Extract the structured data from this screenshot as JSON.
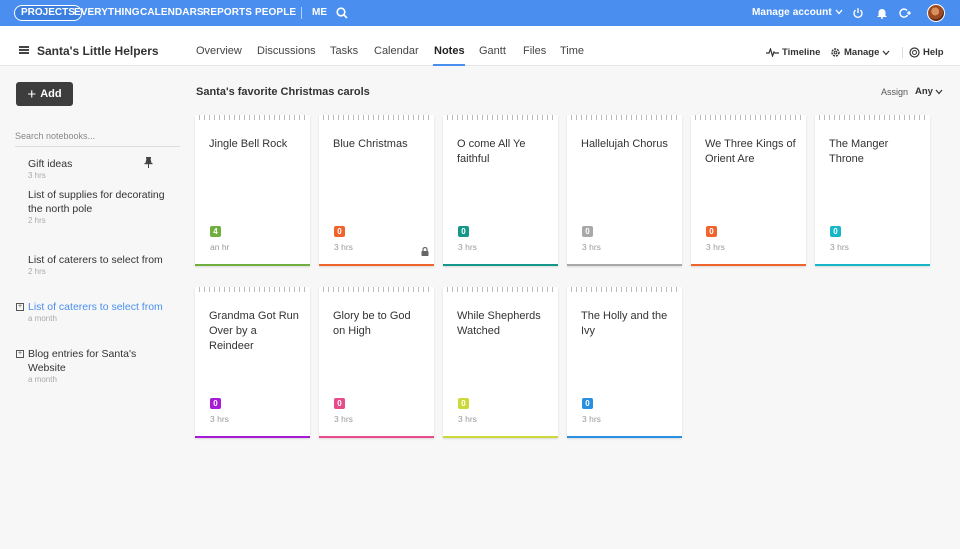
{
  "topnav": {
    "projects": "PROJECTS",
    "everything": "EVERYTHING",
    "calendars": "CALENDARS",
    "reports": "REPORTS",
    "people": "PEOPLE",
    "me": "ME",
    "manage_account": "Manage account",
    "icons": [
      "search-icon",
      "power-icon",
      "bell-icon",
      "add-user-icon",
      "avatar"
    ]
  },
  "header": {
    "project_title": "Santa's Little Helpers",
    "tabs": [
      "Overview",
      "Discussions",
      "Tasks",
      "Calendar",
      "Notes",
      "Gantt",
      "Files",
      "Time"
    ],
    "active_tab": "Notes",
    "timeline": "Timeline",
    "manage": "Manage",
    "help": "Help"
  },
  "sidebar": {
    "add_label": "Add",
    "search_placeholder": "Search notebooks...",
    "notebooks": [
      {
        "title": "Gift ideas",
        "time": "3 hrs",
        "pinned": true
      },
      {
        "title": "List of supplies for decorating the north pole",
        "time": "2 hrs"
      },
      {
        "title": "List of caterers to select from",
        "time": "2 hrs"
      },
      {
        "title": "List of caterers to select from",
        "time": "a month",
        "expandable": true,
        "selected": true
      },
      {
        "title": "Blog entries for Santa's Website",
        "time": "a month",
        "expandable": true
      }
    ]
  },
  "main": {
    "notebook_title": "Santa's favorite Christmas carols",
    "assign_label": "Assign",
    "assign_value": "Any",
    "notes": [
      {
        "title": "Jingle Bell Rock",
        "count": "4",
        "time": "an hr",
        "color": "#6fae3f"
      },
      {
        "title": "Blue Christmas",
        "count": "0",
        "time": "3 hrs",
        "color": "#f0642d",
        "locked": true
      },
      {
        "title": "O come All Ye faithful",
        "count": "0",
        "time": "3 hrs",
        "color": "#15988a"
      },
      {
        "title": "Hallelujah Chorus",
        "count": "0",
        "time": "3 hrs",
        "color": "#a8a8a8"
      },
      {
        "title": "We Three Kings of Orient Are",
        "count": "0",
        "time": "3 hrs",
        "color": "#f0642d"
      },
      {
        "title": "The Manger Throne",
        "count": "0",
        "time": "3 hrs",
        "color": "#17b6c8"
      },
      {
        "title": "Grandma Got Run Over by a Reindeer",
        "count": "0",
        "time": "3 hrs",
        "color": "#a51bd6"
      },
      {
        "title": "Glory be to God on High",
        "count": "0",
        "time": "3 hrs",
        "color": "#e84b8a"
      },
      {
        "title": "While Shepherds Watched",
        "count": "0",
        "time": "3 hrs",
        "color": "#cbd93a"
      },
      {
        "title": "The Holly and the Ivy",
        "count": "0",
        "time": "3 hrs",
        "color": "#2a8fe0"
      }
    ]
  }
}
